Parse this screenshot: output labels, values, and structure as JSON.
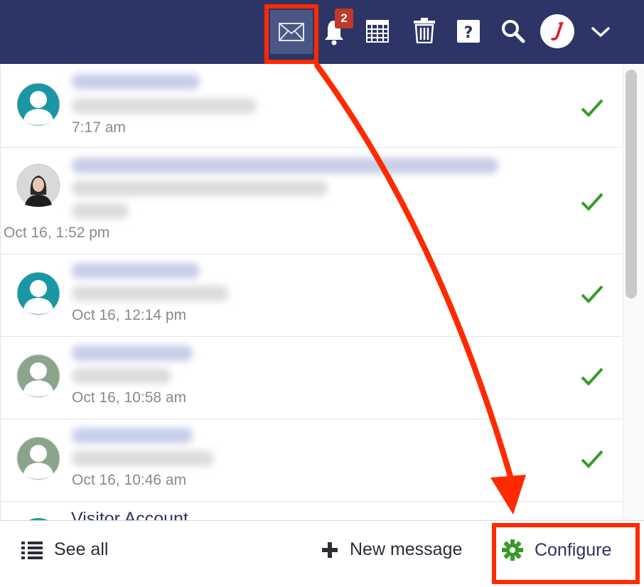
{
  "topbar": {
    "notification_count": "2",
    "icons": [
      "envelope-icon",
      "bell-icon",
      "calendar-icon",
      "trash-icon",
      "help-icon",
      "search-icon",
      "user-avatar",
      "chevron-down-icon"
    ]
  },
  "messages": [
    {
      "time": "7:17 am",
      "avatar": "default"
    },
    {
      "time": "Oct 16, 1:52 pm",
      "avatar": "photo"
    },
    {
      "time": "Oct 16, 12:14 pm",
      "avatar": "default"
    },
    {
      "time": "Oct 16, 10:58 am",
      "avatar": "default-gray"
    },
    {
      "time": "Oct 16, 10:46 am",
      "avatar": "default-gray"
    }
  ],
  "partial_row": {
    "name": "Visitor Account"
  },
  "footer": {
    "see_all": "See all",
    "new_message": "New message",
    "configure": "Configure"
  },
  "colors": {
    "topbar": "#2c3565",
    "check": "#3a9a2a",
    "highlight": "#ff2a00",
    "gear": "#3a9a2a"
  }
}
